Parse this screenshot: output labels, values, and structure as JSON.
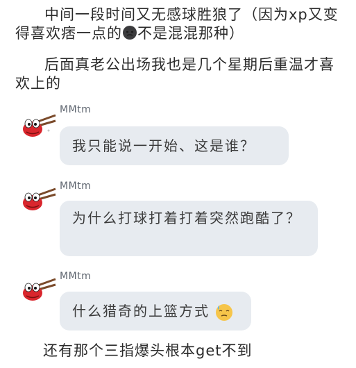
{
  "paragraphs": {
    "p1_before_icon": "中间一段时间又无感球胜狼了（因为xp又变得喜欢痞一点的",
    "p1_after_icon": "不是混混那种）",
    "p1_icon": "dark-face-emoji-icon",
    "p2": "后面真老公出场我也是几个星期后重温才喜欢上的",
    "p3": "还有那个三指爆头根本get不到"
  },
  "messages": [
    {
      "sender": "MMtm",
      "text": "我只能说一开始、这是谁？"
    },
    {
      "sender": "MMtm",
      "text": "为什么打球打着打着突然跑酷了？"
    },
    {
      "sender": "MMtm",
      "text": "什么猎奇的上篮方式",
      "emoji": "sweat-face-emoji-icon"
    }
  ],
  "colors": {
    "bubble": "#e7ebf0",
    "text": "#2b2b2b",
    "avatar_red": "#d9262d"
  }
}
